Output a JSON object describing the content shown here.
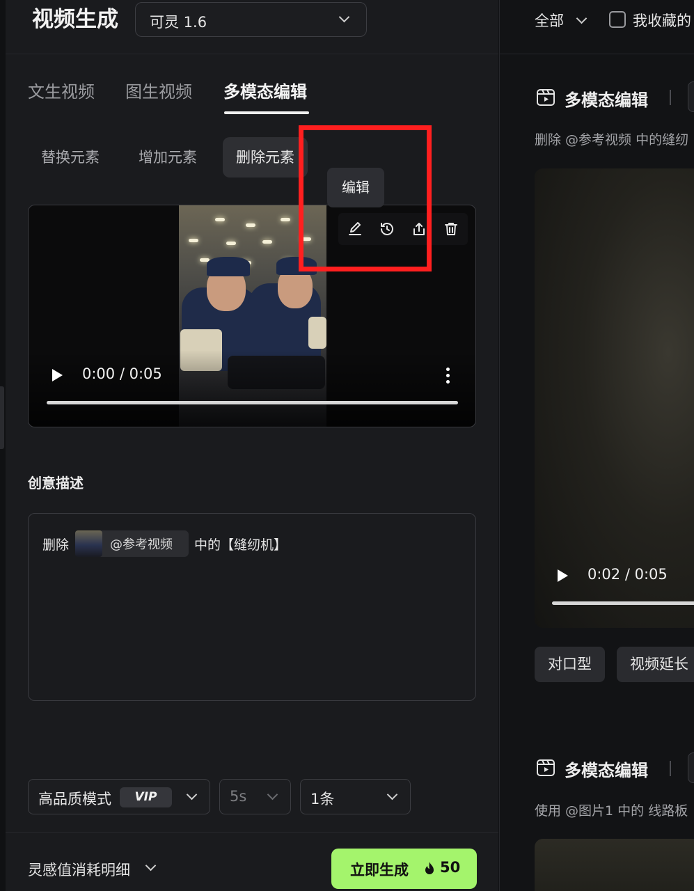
{
  "header": {
    "title": "视频生成",
    "model_select": "可灵 1.6"
  },
  "tabs": [
    {
      "label": "文生视频",
      "active": false
    },
    {
      "label": "图生视频",
      "active": false
    },
    {
      "label": "多模态编辑",
      "active": true
    }
  ],
  "subtabs": [
    {
      "label": "替换元素",
      "active": false
    },
    {
      "label": "增加元素",
      "active": false
    },
    {
      "label": "删除元素",
      "active": true
    }
  ],
  "reference_video": {
    "time": "0:00 / 0:05",
    "progress": 0.0,
    "toolbar": [
      "edit-icon",
      "history-icon",
      "share-icon",
      "trash-icon"
    ],
    "tooltip": "编辑"
  },
  "prompt": {
    "section_label": "创意描述",
    "prefix": "删除",
    "ref_chip": "@参考视频",
    "suffix": "中的【缝纫机】"
  },
  "options": {
    "quality": "高品质模式",
    "quality_badge": "VIP",
    "duration": "5s",
    "count": "1条"
  },
  "footer": {
    "cost_detail": "灵感值消耗明细",
    "generate_label": "立即生成",
    "generate_cost": "50"
  },
  "right_panel": {
    "filter": "全部",
    "favorites_label": "我收藏的",
    "favorites_checked": false,
    "cards": [
      {
        "title": "多模态编辑",
        "desc": "删除 @参考视频 中的缝纫",
        "video_time": "0:02 / 0:05",
        "video_progress": 0.4,
        "tags": [
          "对口型",
          "视频延长"
        ]
      },
      {
        "title": "多模态编辑",
        "desc": "使用 @图片1 中的 线路板"
      }
    ]
  },
  "colors": {
    "accent_green": "#a4f46c",
    "highlight_red": "#ff1f1f",
    "panel_bg": "#1a1b1e"
  }
}
